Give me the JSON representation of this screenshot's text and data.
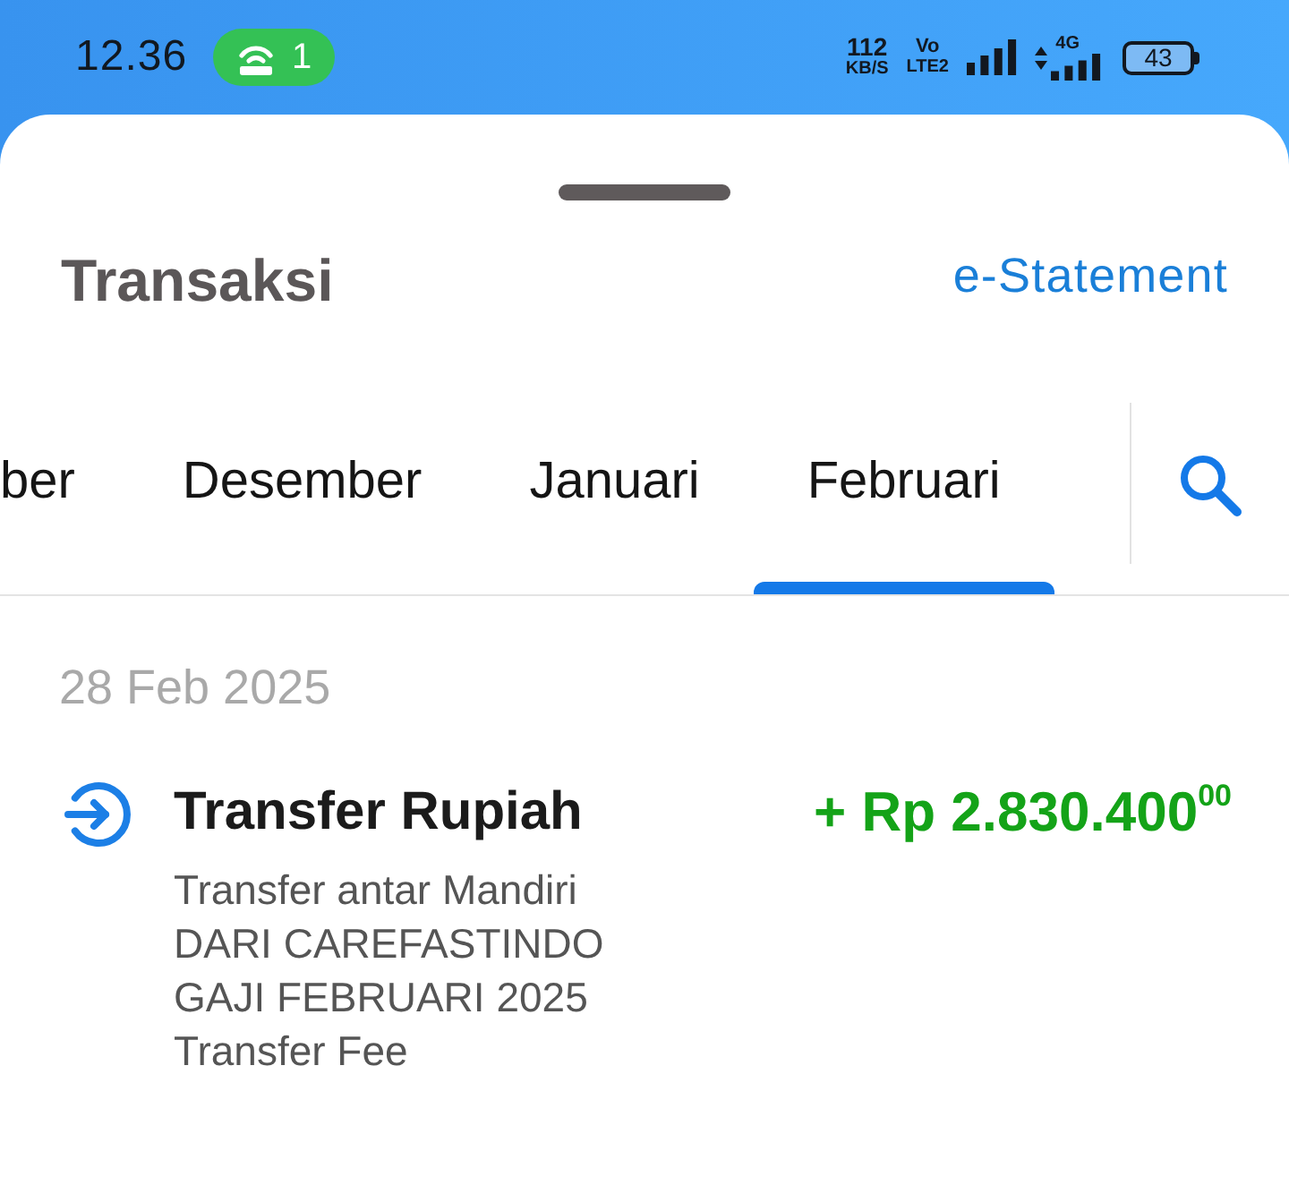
{
  "status_bar": {
    "time": "12.36",
    "hotspot_count": "1",
    "net_speed": "112",
    "net_speed_unit": "KB/S",
    "volte_top": "Vo",
    "volte_bottom": "LTE2",
    "network": "4G",
    "battery": "43"
  },
  "sheet": {
    "title": "Transaksi",
    "link": "e-Statement"
  },
  "month_tabs": [
    {
      "label": "ber",
      "selected": false
    },
    {
      "label": "Desember",
      "selected": false
    },
    {
      "label": "Januari",
      "selected": false
    },
    {
      "label": "Februari",
      "selected": true
    }
  ],
  "groups": [
    {
      "date": "28 Feb 2025",
      "transactions": [
        {
          "kind": "credit",
          "title": "Transfer Rupiah",
          "amount": "+ Rp 2.830.400$^{00}$",
          "details": [
            "Transfer antar Mandiri",
            "DARI CAREFASTINDO",
            "GAJI FEBRUARI 2025",
            "Transfer Fee"
          ]
        }
      ]
    }
  ]
}
